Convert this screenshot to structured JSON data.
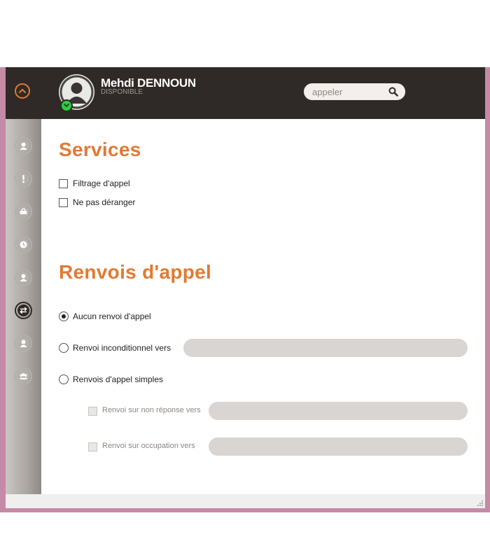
{
  "header": {
    "user_name": "Mehdi DENNOUN",
    "user_status": "DISPONIBLE",
    "search_placeholder": "appeler"
  },
  "sidebar": {
    "items": [
      {
        "icon": "user-icon"
      },
      {
        "icon": "alert-icon"
      },
      {
        "icon": "voicemail-icon"
      },
      {
        "icon": "history-icon"
      },
      {
        "icon": "contact-icon"
      },
      {
        "icon": "transfer-icon",
        "active": true
      },
      {
        "icon": "profile-icon"
      },
      {
        "icon": "group-icon"
      }
    ]
  },
  "services": {
    "title": "Services",
    "options": [
      {
        "label": "Filtrage d'appel",
        "checked": false
      },
      {
        "label": "Ne pas déranger",
        "checked": false
      }
    ]
  },
  "forwarding": {
    "title": "Renvois d'appel",
    "none_label": "Aucun renvoi d'appel",
    "unconditional_label": "Renvoi inconditionnel vers",
    "simple_label": "Renvois d'appel simples",
    "no_answer_label": "Renvoi sur non réponse vers",
    "busy_label": "Renvoi sur occupation vers",
    "selected": "none"
  },
  "colors": {
    "accent": "#e07a34",
    "header_bg": "#2f2a27",
    "status_online": "#2ecc40",
    "window_frame": "#c58aa6"
  }
}
